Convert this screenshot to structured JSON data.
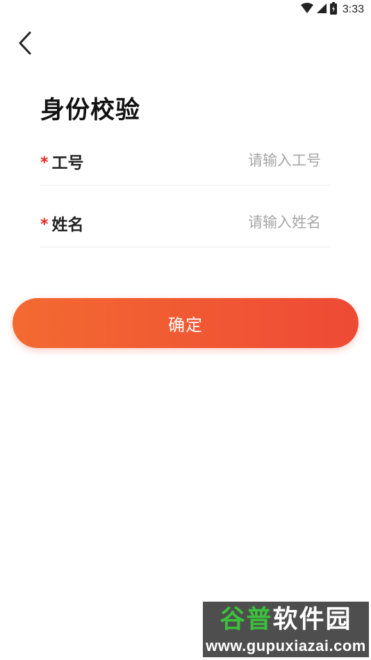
{
  "status_bar": {
    "time": "3:33",
    "icons": [
      "wifi-icon",
      "cell-signal-icon",
      "battery-icon"
    ]
  },
  "header": {
    "back_icon": "chevron-left-icon"
  },
  "page": {
    "title": "身份校验"
  },
  "form": {
    "required_mark": "*",
    "fields": [
      {
        "label": "工号",
        "value": "",
        "placeholder": "请输入工号"
      },
      {
        "label": "姓名",
        "value": "",
        "placeholder": "请输入姓名"
      }
    ]
  },
  "actions": {
    "confirm_label": "确定"
  },
  "watermark": {
    "title_part1": "谷普",
    "title_part2": "软件园",
    "url": "www.gupuxiazai.com"
  },
  "colors": {
    "accent_start": "#f36a31",
    "accent_end": "#ee4a35",
    "required": "#e8281e",
    "watermark_green": "#3bc13b"
  }
}
